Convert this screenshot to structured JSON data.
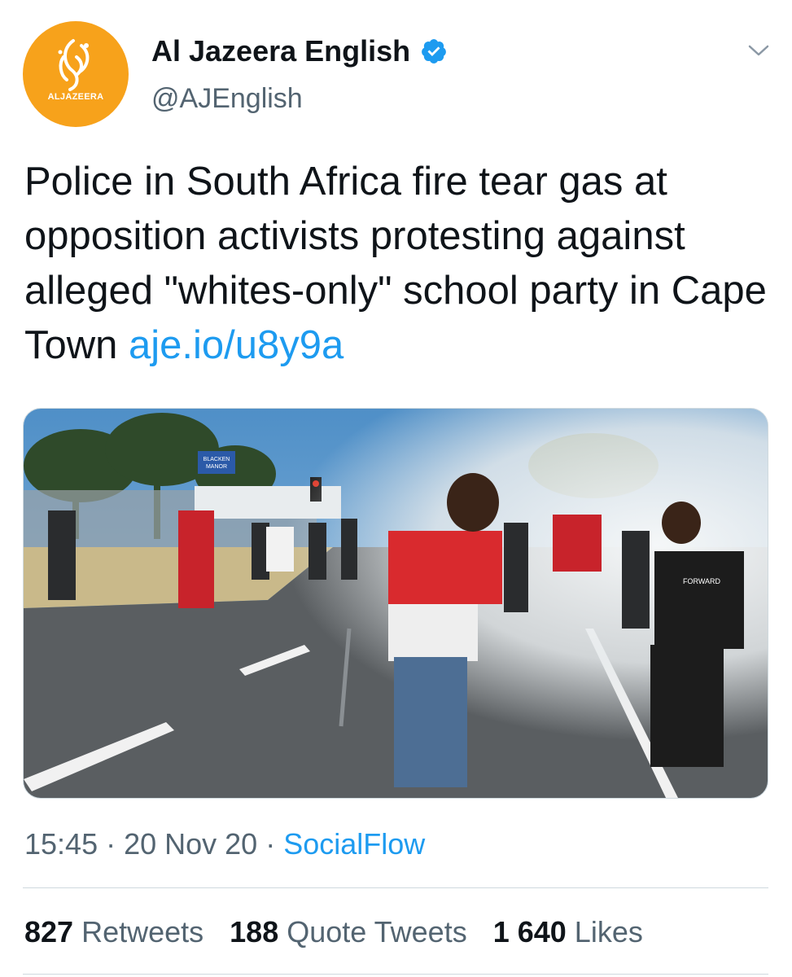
{
  "colors": {
    "brand_orange": "#f7a21b",
    "link_blue": "#1d9bf0",
    "secondary_text": "#536471",
    "verified_blue": "#1d9bf0"
  },
  "author": {
    "display_name": "Al Jazeera English",
    "handle": "@AJEnglish",
    "avatar_logo_text": "ALJAZEERA",
    "verified_icon": "verified-badge-icon",
    "menu_icon": "chevron-down-icon"
  },
  "tweet": {
    "text": "Police in South Africa fire tear gas at opposition activists protesting against alleged \"whites-only\" school party in Cape Town ",
    "link": "aje.io/u8y9a"
  },
  "media": {
    "sign_text": "BLACKEN MANOR",
    "shirt_text": "FORWARD"
  },
  "meta": {
    "time": "15:45",
    "separator_1": " · ",
    "date": "20 Nov 20",
    "separator_2": " · ",
    "source": "SocialFlow"
  },
  "stats": {
    "retweets_count": "827",
    "retweets_label": "Retweets",
    "quote_tweets_count": "188",
    "quote_tweets_label": "Quote Tweets",
    "likes_count": "1 640",
    "likes_label": "Likes"
  }
}
